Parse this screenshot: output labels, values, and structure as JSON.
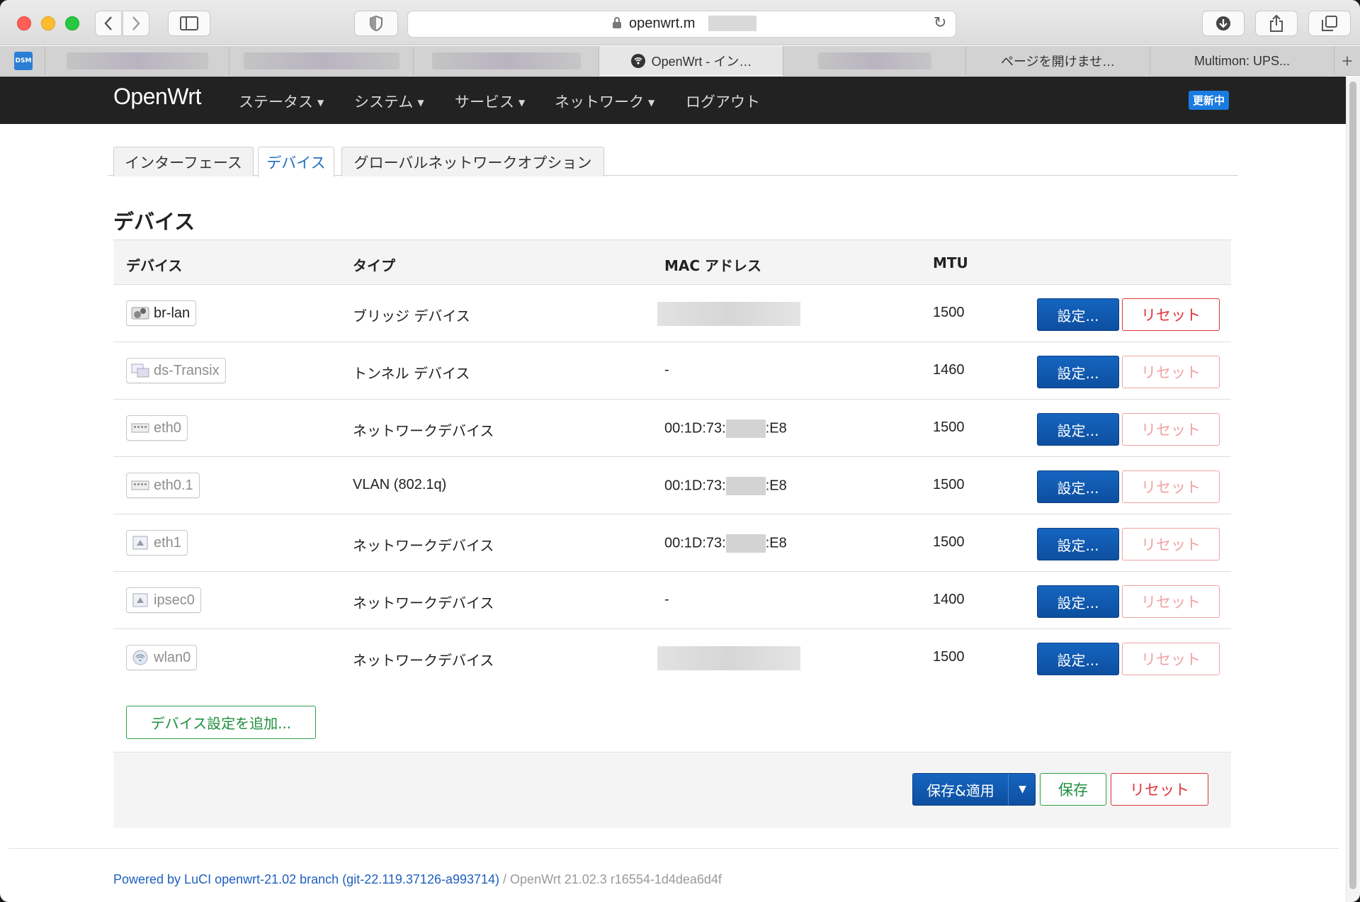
{
  "browser": {
    "url_text": "openwrt.m",
    "tabs": [
      {
        "label": ""
      },
      {
        "label": ""
      },
      {
        "label": ""
      },
      {
        "label": "OpenWrt - イン…"
      },
      {
        "label": ""
      },
      {
        "label": "ページを開けませ…"
      },
      {
        "label": "Multimon: UPS..."
      }
    ],
    "dsm_label": "DSM",
    "new_tab": "+"
  },
  "header": {
    "brand": "OpenWrt",
    "nav": [
      {
        "label": "ステータス",
        "has_menu": true
      },
      {
        "label": "システム",
        "has_menu": true
      },
      {
        "label": "サービス",
        "has_menu": true
      },
      {
        "label": "ネットワーク",
        "has_menu": true
      },
      {
        "label": "ログアウト",
        "has_menu": false
      }
    ],
    "status_badge": "更新中"
  },
  "page_tabs": [
    {
      "label": "インターフェース",
      "active": false
    },
    {
      "label": "デバイス",
      "active": true
    },
    {
      "label": "グローバルネットワークオプション",
      "active": false
    }
  ],
  "page_title": "デバイス",
  "table": {
    "headers": [
      "デバイス",
      "タイプ",
      "MAC アドレス",
      "MTU"
    ],
    "rows": [
      {
        "device": "br-lan",
        "type": "ブリッジ デバイス",
        "mac": "",
        "mac_hidden": true,
        "mtu": "1500",
        "active": true
      },
      {
        "device": "ds-Transix",
        "type": "トンネル デバイス",
        "mac": "-",
        "mac_hidden": false,
        "mtu": "1460",
        "active": false
      },
      {
        "device": "eth0",
        "type": "ネットワークデバイス",
        "mac_prefix": "00:1D:73:",
        "mac_suffix": ":E8",
        "mac_partial": true,
        "mtu": "1500",
        "active": false
      },
      {
        "device": "eth0.1",
        "type": "VLAN (802.1q)",
        "mac_prefix": "00:1D:73:",
        "mac_suffix": ":E8",
        "mac_partial": true,
        "mtu": "1500",
        "active": false
      },
      {
        "device": "eth1",
        "type": "ネットワークデバイス",
        "mac_prefix": "00:1D:73:",
        "mac_suffix": ":E8",
        "mac_partial": true,
        "mtu": "1500",
        "active": false
      },
      {
        "device": "ipsec0",
        "type": "ネットワークデバイス",
        "mac": "-",
        "mac_hidden": false,
        "mtu": "1400",
        "active": false
      },
      {
        "device": "wlan0",
        "type": "ネットワークデバイス",
        "mac": "",
        "mac_hidden": true,
        "mtu": "1500",
        "active": false
      }
    ],
    "configure_label": "設定...",
    "reset_label": "リセット"
  },
  "add_device_label": "デバイス設定を追加...",
  "actions": {
    "save_apply": "保存&適用",
    "save": "保存",
    "reset": "リセット"
  },
  "footer": {
    "powered": "Powered by LuCI openwrt-21.02 branch (git-22.119.37126-a993714)",
    "separator": " / ",
    "version": "OpenWrt 21.02.3 r16554-1d4dea6d4f"
  },
  "colors": {
    "primary_blue": "#1565c0",
    "danger_red": "#e0333a",
    "success_green": "#2ea04a",
    "header_bg": "#222222"
  }
}
